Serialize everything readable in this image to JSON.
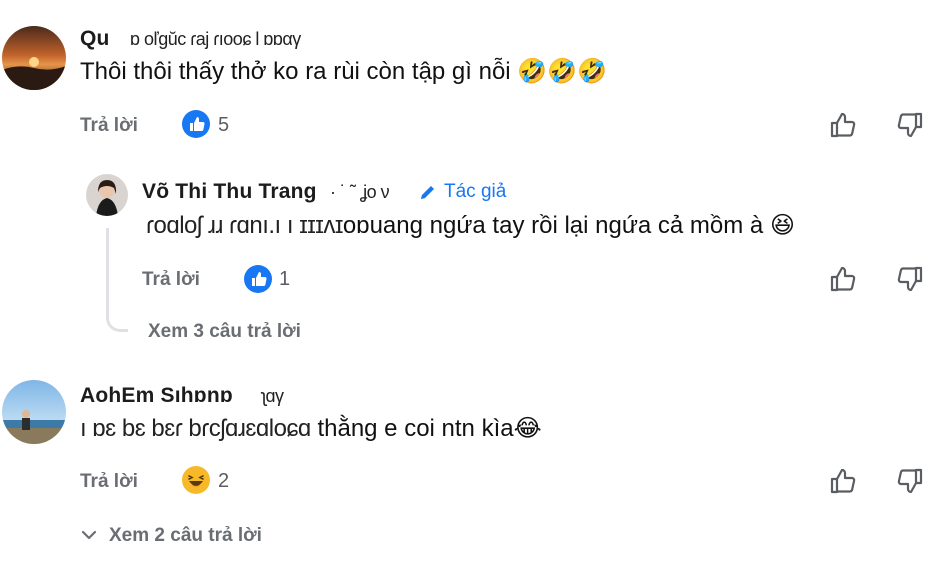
{
  "comments": [
    {
      "author": "Qu",
      "meta_garbled": "ɒ oľgŭc ɾaj  ɾıooɕ l ɒɒαγ",
      "text": "Thôi thôi thấy thở ko ra rùi còn tập gì nỗi",
      "emojis": "🤣🤣🤣",
      "reply_label": "Trả lời",
      "reaction_icon": "like-icon",
      "reaction_count": "5"
    },
    {
      "author": "Võ Thi Thu Trang",
      "meta_garbled": "· ˙ ˜ ʝo ν",
      "author_tag": "Tác giả",
      "text_garbled": "ɾoɑloʃ ɹɹ ɾɑnı.ı ı ɪɪɪʌɪ",
      "text": "oɒuang ngứa tay rồi lại ngứa cả mồm à",
      "emojis": "😆",
      "reply_label": "Trả lời",
      "reaction_icon": "like-icon",
      "reaction_count": "1",
      "view_replies": "Xem 3 câu trả lời"
    },
    {
      "author": "AohEm Sıhɒnɒ",
      "meta_garbled": "ʅɑγ",
      "text_garbled": "ı ɒɛ bɛ bɛɾ bɾcʃɑɹɛɑloɕɑ",
      "text": "thằng e coi ntn kìa",
      "emojis": "😂",
      "reply_label": "Trả lời",
      "reaction_icon": "haha-icon",
      "reaction_count": "2",
      "view_replies": "Xem 2 câu trả lời"
    }
  ],
  "colors": {
    "link_blue": "#1877f2",
    "muted": "#6a6d72",
    "thread_line": "#dfe1e5"
  }
}
